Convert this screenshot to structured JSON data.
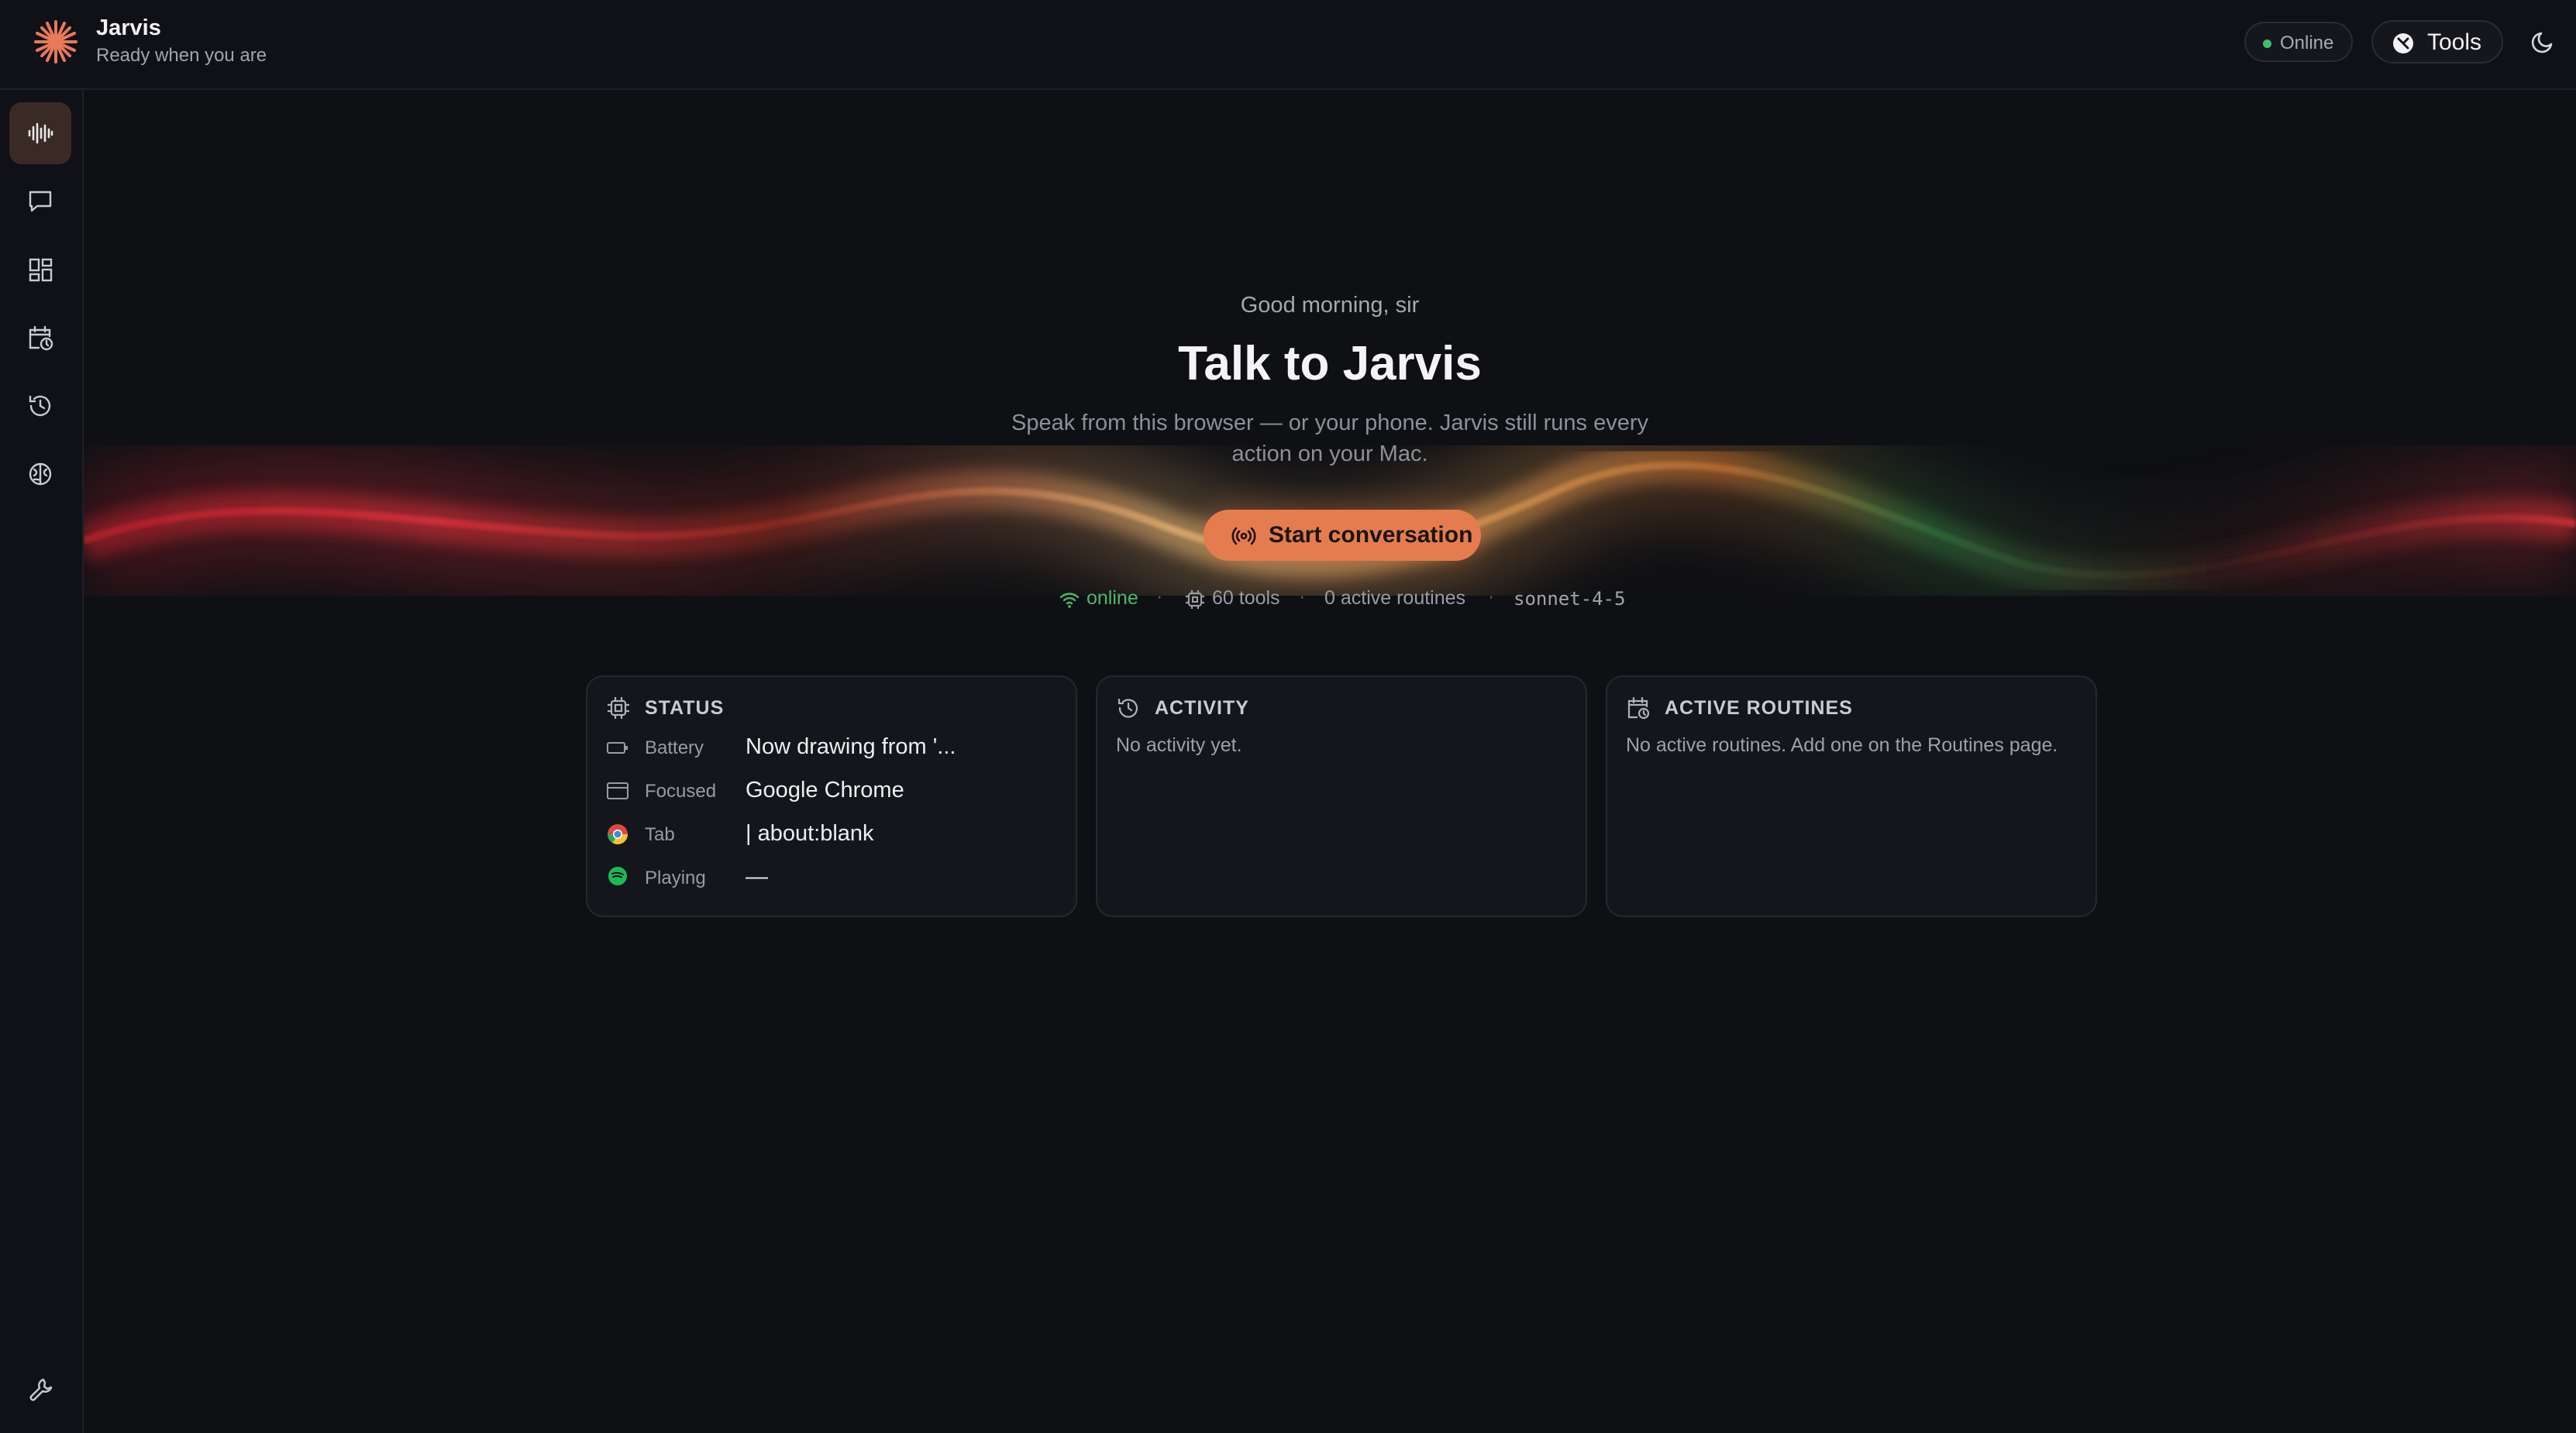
{
  "app": {
    "title": "Jarvis",
    "subtitle": "Ready when you are"
  },
  "header": {
    "status_pill": "Online",
    "tools_label": "Tools"
  },
  "sidebar": {
    "items": [
      {
        "icon": "waveform-icon",
        "active": true
      },
      {
        "icon": "chat-icon",
        "active": false
      },
      {
        "icon": "dashboard-icon",
        "active": false
      },
      {
        "icon": "calendar-clock-icon",
        "active": false
      },
      {
        "icon": "history-icon",
        "active": false
      },
      {
        "icon": "brain-icon",
        "active": false
      }
    ],
    "bottom_icon": "wrench-icon"
  },
  "hero": {
    "greeting": "Good morning, sir",
    "headline": "Talk to Jarvis",
    "description": "Speak from this browser — or your phone. Jarvis still runs every action on your Mac.",
    "start_button": "Start conversation"
  },
  "meta": {
    "connection": "online",
    "tools": "60 tools",
    "routines": "0 active routines",
    "model": "sonnet-4-5",
    "separator": "·"
  },
  "cards": {
    "status": {
      "title": "STATUS",
      "rows": [
        {
          "label": "Battery",
          "value": "Now drawing from '..."
        },
        {
          "label": "Focused",
          "value": "Google Chrome"
        },
        {
          "label": "Tab",
          "value": "| about:blank"
        },
        {
          "label": "Playing",
          "value": "—"
        }
      ]
    },
    "activity": {
      "title": "ACTIVITY",
      "empty": "No activity yet."
    },
    "routines": {
      "title": "ACTIVE ROUTINES",
      "empty": "No active routines. Add one on the Routines page."
    }
  },
  "colors": {
    "background": "#0f1014",
    "accent": "#e57c50",
    "online": "#3fbf6a"
  }
}
